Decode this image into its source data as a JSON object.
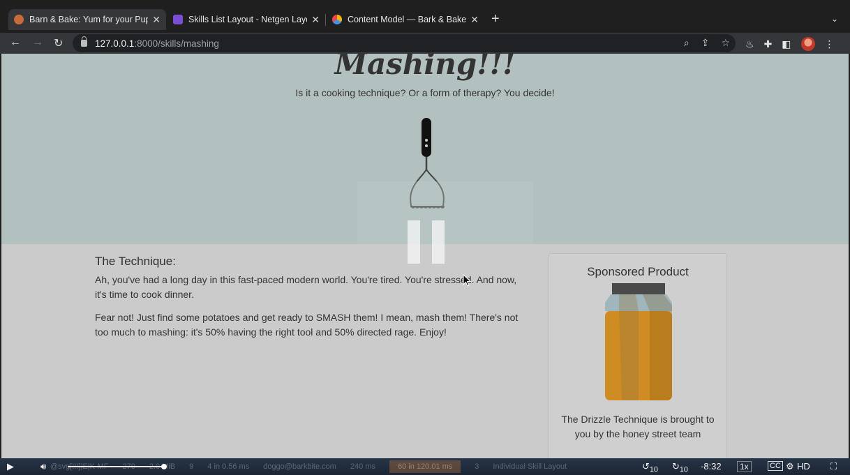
{
  "browser": {
    "tabs": [
      {
        "label": "Barn & Bake: Yum for your Pup",
        "close": "✕",
        "icon": "bark-and-bake-favicon",
        "color": "#d1763b"
      },
      {
        "label": "Skills List Layout - Netgen Layouts",
        "close": "✕",
        "icon": "netgen-layouts-favicon",
        "color": "#7a4fd6"
      },
      {
        "label": "Content Model — Bark & Bake",
        "close": "✕",
        "icon": "contentful-favicon",
        "color": "#f2b600"
      }
    ],
    "new_tab": "+",
    "tab_menu": "⌄",
    "url_host": "127.0.0.1",
    "url_path": ":8000/skills/mashing"
  },
  "hero": {
    "title": "Mashing!!!",
    "subtitle": "Is it a cooking technique? Or a form of therapy? You decide!",
    "background": "#b2c1bf"
  },
  "technique": {
    "heading": "The Technique:",
    "paragraph1": "Ah, you've had a long day in this fast-paced modern world. You're tired. You're stressed. And now, it's time to cook dinner.",
    "paragraph2": "Fear not! Just find some potatoes and get ready to SMASH them! I mean, mash them! There's not too much to mashing: it's 50% having the right tool and 50% directed rage. Enjoy!"
  },
  "sponsor": {
    "heading": "Sponsored Product",
    "text": "The Drizzle Technique is brought to you by the honey street team"
  },
  "video": {
    "time_remaining": "-8:32",
    "speed": "1x",
    "quality": "HD",
    "rewind_label": "10",
    "forward_label": "10",
    "debug_items": [
      "@svg[!!!]|E|K-MF",
      "270",
      "2.0 MiB",
      "9",
      "4 in 0.56 ms",
      "doggo@barkbite.com",
      "240 ms",
      "60 in 120.01 ms",
      "3",
      "Individual Skill Layout"
    ]
  }
}
